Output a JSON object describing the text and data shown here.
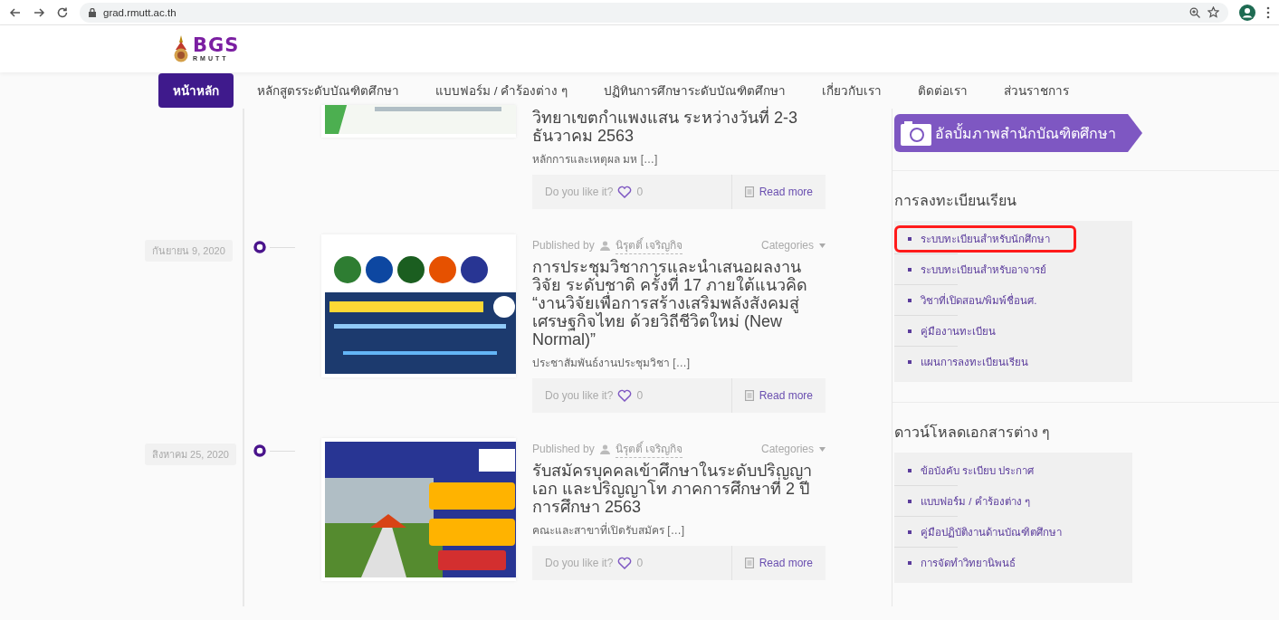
{
  "browser": {
    "url": "grad.rmutt.ac.th"
  },
  "logo": {
    "mark": "BGS",
    "sub": "RMUTT"
  },
  "nav": {
    "items": [
      {
        "label": "หน้าหลัก",
        "selected": true
      },
      {
        "label": "หลักสูตรระดับบัณฑิตศึกษา",
        "selected": false
      },
      {
        "label": "แบบฟอร์ม / คำร้องต่าง ๆ",
        "selected": false
      },
      {
        "label": "ปฏิทินการศึกษาระดับบัณฑิตศึกษา",
        "selected": false
      },
      {
        "label": "เกี่ยวกับเรา",
        "selected": false
      },
      {
        "label": "ติดต่อเรา",
        "selected": false
      },
      {
        "label": "ส่วนราชการ",
        "selected": false
      }
    ]
  },
  "posts": [
    {
      "title": "วิทยาเขตกำแพงแสน ระหว่างวันที่ 2-3 ธันวาคม 2563",
      "excerpt": "หลักการและเหตุผล มห […]",
      "like_label": "Do you like it?",
      "likes": "0",
      "read_more": "Read more"
    },
    {
      "date": "กันยายน 9, 2020",
      "published_by": "Published by",
      "author": "นิรุตติ์ เจริญกิจ",
      "categories": "Categories",
      "title": "การประชุมวิชาการและนำเสนอผลงานวิจัย ระดับชาติ ครั้งที่ 17 ภายใต้แนวคิด “งานวิจัยเพื่อการสร้างเสริมพลังสังคมสู่เศรษฐกิจไทย ด้วยวิถีชีวิตใหม่ (New Normal)”",
      "excerpt": "ประชาสัมพันธ์งานประชุมวิชา […]",
      "like_label": "Do you like it?",
      "likes": "0",
      "read_more": "Read more"
    },
    {
      "date": "สิงหาคม 25, 2020",
      "published_by": "Published by",
      "author": "นิรุตติ์ เจริญกิจ",
      "categories": "Categories",
      "title": "รับสมัครบุคคลเข้าศึกษาในระดับปริญญาเอก และปริญญาโท ภาคการศึกษาที่ 2 ปีการศึกษา 2563",
      "excerpt": "คณะและสาขาที่เปิดรับสมัคร […]",
      "like_label": "Do you like it?",
      "likes": "0",
      "read_more": "Read more"
    }
  ],
  "sidebar": {
    "album": "อัลบั้มภาพสำนักบัณฑิตศึกษา",
    "widgets": [
      {
        "title": "การลงทะเบียนเรียน",
        "items": [
          {
            "label": "ระบบทะเบียนสำหรับนักศึกษา",
            "highlighted": true
          },
          {
            "label": "ระบบทะเบียนสำหรับอาจารย์",
            "highlighted": false
          },
          {
            "label": "วิชาที่เปิดสอน/พิมพ์ชื่อนศ.",
            "highlighted": false
          },
          {
            "label": "คู่มืองานทะเบียน",
            "highlighted": false
          },
          {
            "label": "แผนการลงทะเบียนเรียน",
            "highlighted": false
          }
        ]
      },
      {
        "title": "ดาวน์โหลดเอกสารต่าง ๆ",
        "items": [
          {
            "label": "ข้อบังคับ ระเบียบ ประกาศ",
            "highlighted": false
          },
          {
            "label": "แบบฟอร์ม / คำร้องต่าง ๆ",
            "highlighted": false
          },
          {
            "label": "คู่มือปฏิบัติงานด้านบัณฑิตศึกษา",
            "highlighted": false
          },
          {
            "label": "การจัดทำวิทยานิพนธ์",
            "highlighted": false
          }
        ]
      }
    ]
  }
}
